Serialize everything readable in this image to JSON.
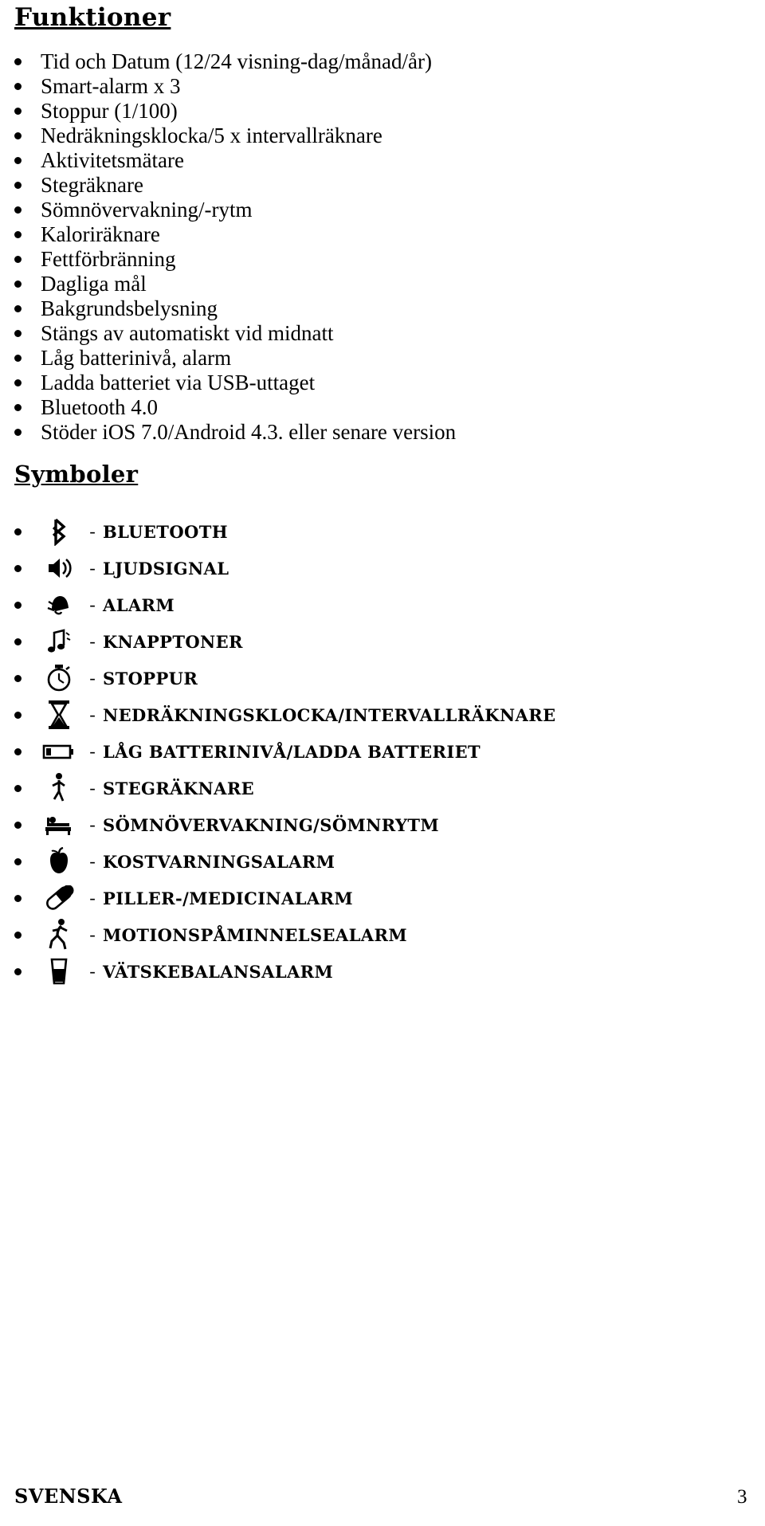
{
  "document": {
    "sections": {
      "features_heading": "Funktioner",
      "symbols_heading": "Symboler"
    },
    "features": [
      "Tid och Datum (12/24 visning-dag/månad/år)",
      "Smart-alarm x 3",
      "Stoppur (1/100)",
      "Nedräkningsklocka/5 x intervallräknare",
      "Aktivitetsmätare",
      "Stegräknare",
      "Sömnövervakning/-rytm",
      "Kaloriräknare",
      "Fettförbränning",
      "Dagliga mål",
      "Bakgrundsbelysning",
      "Stängs av automatiskt vid midnatt",
      "Låg batterinivå, alarm",
      "Ladda batteriet via USB-uttaget",
      "Bluetooth 4.0",
      "Stöder iOS 7.0/Android 4.3. eller senare version"
    ],
    "symbols": [
      {
        "icon": "bluetooth-icon",
        "dash": "-",
        "label": "BLUETOOTH"
      },
      {
        "icon": "sound-signal-icon",
        "dash": "-",
        "label": "LJUDSIGNAL"
      },
      {
        "icon": "alarm-bell-icon",
        "dash": "-",
        "label": "ALARM"
      },
      {
        "icon": "key-tones-icon",
        "dash": "-",
        "label": "KNAPPTONER"
      },
      {
        "icon": "stopwatch-icon",
        "dash": "-",
        "label": "STOPPUR"
      },
      {
        "icon": "hourglass-icon",
        "dash": "-",
        "label": "NEDRÄKNINGSKLOCKA/INTERVALLRÄKNARE"
      },
      {
        "icon": "low-battery-icon",
        "dash": "-",
        "label": "LÅG BATTERINIVÅ/LADDA BATTERIET"
      },
      {
        "icon": "pedometer-walk-icon",
        "dash": "-",
        "label": "STEGRÄKNARE"
      },
      {
        "icon": "sleep-bed-icon",
        "dash": "-",
        "label": "SÖMNÖVERVAKNING/SÖMNRYTM"
      },
      {
        "icon": "apple-food-icon",
        "dash": "-",
        "label": "KOSTVARNINGSALARM"
      },
      {
        "icon": "pill-icon",
        "dash": "-",
        "label": "PILLER-/MEDICINALARM"
      },
      {
        "icon": "running-person-icon",
        "dash": "-",
        "label": "MOTIONSPÅMINNELSEALARM"
      },
      {
        "icon": "water-glass-icon",
        "dash": "-",
        "label": "VÄTSKEBALANSALARM"
      }
    ],
    "footer": {
      "language": "SVENSKA",
      "page_number": "3"
    }
  }
}
